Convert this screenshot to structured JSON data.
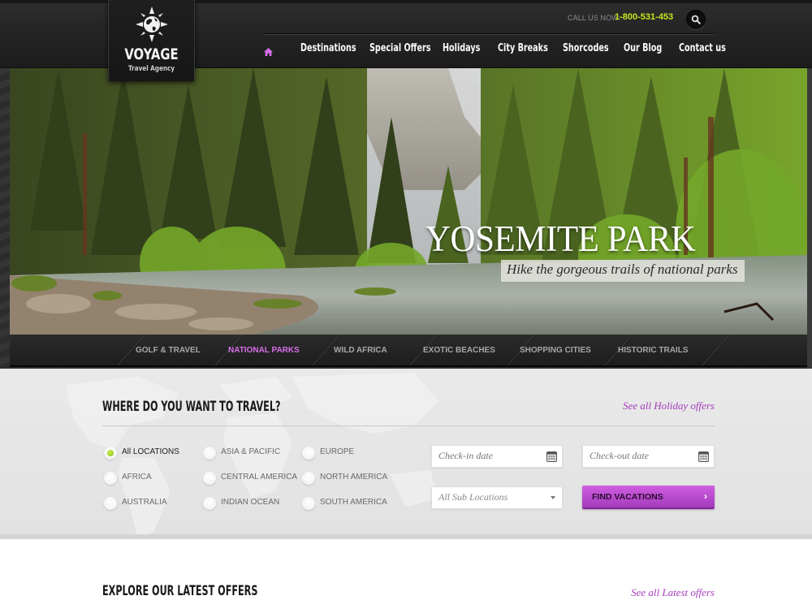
{
  "brand": {
    "name": "VOYAGE",
    "tagline": "Travel Agency",
    "logo_icon": "compass-globe-icon"
  },
  "header": {
    "call_label": "CALL US NOW:",
    "phone": "1-800-531-453",
    "search_icon": "search-icon",
    "home_icon": "home-icon",
    "nav": [
      {
        "label": "Destinations"
      },
      {
        "label": "Special Offers"
      },
      {
        "label": "Holidays"
      },
      {
        "label": "City Breaks"
      },
      {
        "label": "Shorcodes"
      },
      {
        "label": "Our Blog"
      },
      {
        "label": "Contact us"
      }
    ]
  },
  "hero": {
    "title": "YOSEMITE PARK",
    "subtitle": "Hike the gorgeous trails of national parks",
    "categories": [
      {
        "label": "GOLF & TRAVEL",
        "active": false
      },
      {
        "label": "NATIONAL PARKS",
        "active": true
      },
      {
        "label": "WILD AFRICA",
        "active": false
      },
      {
        "label": "EXOTIC BEACHES",
        "active": false
      },
      {
        "label": "SHOPPING CITIES",
        "active": false
      },
      {
        "label": "HISTORIC TRAILS",
        "active": false
      }
    ]
  },
  "search": {
    "title": "WHERE DO YOU WANT TO TRAVEL?",
    "offers_link": "See all Holiday offers",
    "locations": [
      {
        "label": "All LOCATIONS",
        "checked": true
      },
      {
        "label": "ASIA & PACIFIC",
        "checked": false
      },
      {
        "label": "EUROPE",
        "checked": false
      },
      {
        "label": "AFRICA",
        "checked": false
      },
      {
        "label": "CENTRAL AMERICA",
        "checked": false
      },
      {
        "label": "NORTH AMERICA",
        "checked": false
      },
      {
        "label": "AUSTRALIA",
        "checked": false
      },
      {
        "label": "INDIAN OCEAN",
        "checked": false
      },
      {
        "label": "SOUTH AMERICA",
        "checked": false
      }
    ],
    "checkin_placeholder": "Check-in date",
    "checkout_placeholder": "Check-out date",
    "sublocation_value": "All Sub Locations",
    "find_button": "FIND VACATIONS",
    "find_chevron": "›"
  },
  "latest": {
    "title": "EXPLORE OUR LATEST OFFERS",
    "link": "See all Latest offers"
  },
  "colors": {
    "accent_purple": "#a63cbd",
    "active_tab": "#d66ee7",
    "phone_green": "#c8e41a",
    "radio_checked": "#8cc21a"
  }
}
